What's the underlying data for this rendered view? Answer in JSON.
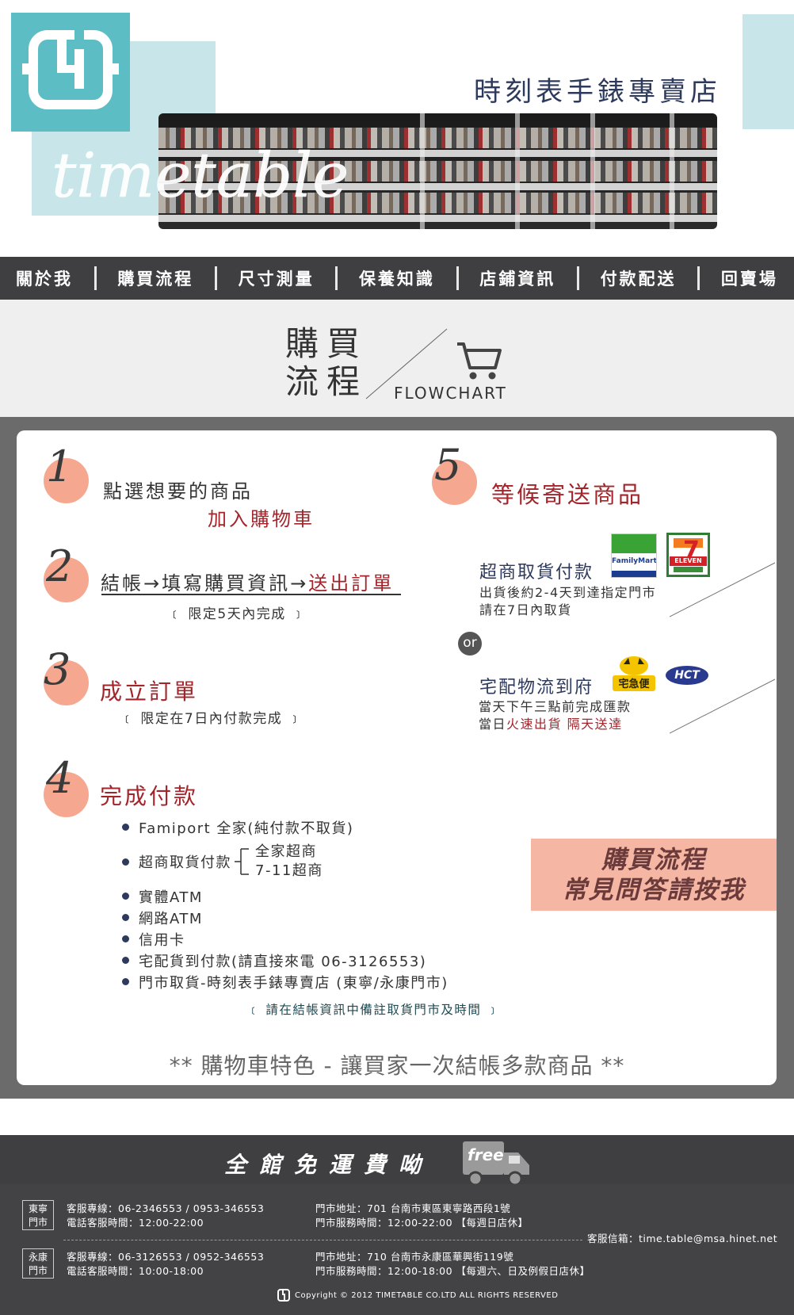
{
  "header": {
    "shop_title": "時刻表手錶專賣店",
    "script_logo": "timetable",
    "brand_color": "#5cbdc4"
  },
  "nav": {
    "items": [
      "關於我",
      "購買流程",
      "尺寸測量",
      "保養知識",
      "店鋪資訊",
      "付款配送",
      "回賣場"
    ]
  },
  "section": {
    "title_line1": "購買",
    "title_line2": "流程",
    "title_en": "FLOWCHART"
  },
  "steps": {
    "s1": {
      "num": "1",
      "line1": "點選想要的商品",
      "line2": "加入購物車"
    },
    "s2": {
      "num": "2",
      "part1": "結帳",
      "arrow1": "→",
      "part2": "填寫購買資訊",
      "arrow2": "→",
      "part3": "送出訂單",
      "note": "﹝ 限定5天內完成 ﹞"
    },
    "s3": {
      "num": "3",
      "title": "成立訂單",
      "note": "﹝ 限定在7日內付款完成 ﹞"
    },
    "s4": {
      "num": "4",
      "title": "完成付款",
      "famiport": "Famiport 全家(純付款不取貨)",
      "cvs_pay": "超商取貨付款",
      "cvs_opt1": "全家超商",
      "cvs_opt2": "7-11超商",
      "atm_physical": "實體ATM",
      "atm_web": "網路ATM",
      "credit_card": "信用卡",
      "cod": "宅配貨到付款(請直接來電 06-3126553)",
      "pickup": "門市取貨-時刻表手錶專賣店 (東寧/永康門市)",
      "pickup_note": "﹝ 請在結帳資訊中備註取貨門市及時間 ﹞"
    },
    "s5": {
      "num": "5",
      "title": "等候寄送商品",
      "cvs_title": "超商取貨付款",
      "cvs_line1": "出貨後約2-4天到達指定門市",
      "cvs_line2": "請在7日內取貨",
      "or": "or",
      "home_title": "宅配物流到府",
      "home_line1": "當天下午三點前完成匯款",
      "home_line2_a": "當日",
      "home_line2_b": "火速出貨  隔天送達",
      "logo_familymart": "FamilyMart",
      "logo_seven": "ELEVEN",
      "logo_cat": "宅急便",
      "logo_hct": "HCT"
    }
  },
  "faq_button": {
    "line1": "購買流程",
    "line2": "常見問答請按我"
  },
  "feature": "** 購物車特色 - 讓買家一次結帳多款商品 **",
  "footer": {
    "free_text": "全館免運費呦",
    "free_badge": "free",
    "stores": [
      {
        "tag_line1": "東寧",
        "tag_line2": "門市",
        "phone": "客服專線：06-2346553 / 0953-346553",
        "phone_hours": "電話客服時間：12:00-22:00",
        "address": "門市地址：701 台南市東區東寧路西段1號",
        "store_hours": "門市服務時間：12:00-22:00 【每週日店休】"
      },
      {
        "tag_line1": "永康",
        "tag_line2": "門市",
        "phone": "客服專線：06-3126553 / 0952-346553",
        "phone_hours": "電話客服時間：10:00-18:00",
        "address": "門市地址：710 台南市永康區華興街119號",
        "store_hours": "門市服務時間：12:00-18:00 【每週六、日及例假日店休】"
      }
    ],
    "email": "客服信箱：time.table@msa.hinet.net",
    "copyright": "Copyright © 2012 TIMETABLE CO.LTD ALL RIGHTS RESERVED"
  }
}
